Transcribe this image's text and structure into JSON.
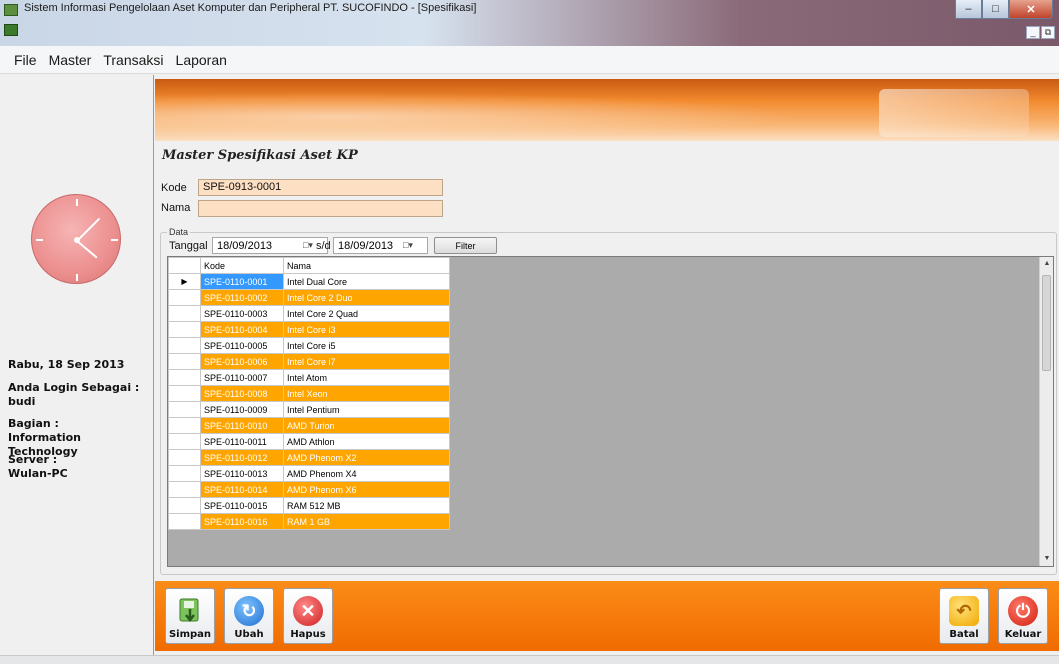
{
  "window": {
    "title": "Sistem Informasi Pengelolaan Aset Komputer dan Peripheral PT. SUCOFINDO - [Spesifikasi]"
  },
  "menu": {
    "items": [
      "File",
      "Master",
      "Transaksi",
      "Laporan"
    ]
  },
  "sidebar": {
    "date": "Rabu, 18 Sep 2013",
    "login_label": "Anda Login Sebagai :",
    "login_user": "budi",
    "bagian_label": "Bagian :",
    "bagian_value": "Information Technology",
    "server_label": "Server :",
    "server_value": "Wulan-PC"
  },
  "form": {
    "title": "Master Spesifikasi Aset KP",
    "kode_label": "Kode",
    "kode_value": "SPE-0913-0001",
    "nama_label": "Nama",
    "nama_value": "",
    "data_group_label": "Data",
    "tanggal_label": "Tanggal",
    "date_from": "18/09/2013",
    "sd_label": "s/d",
    "date_to": "18/09/2013",
    "filter_label": "Filter"
  },
  "grid": {
    "columns": [
      "Kode",
      "Nama"
    ],
    "rows": [
      [
        "SPE-0110-0001",
        "Intel Dual Core"
      ],
      [
        "SPE-0110-0002",
        "Intel Core 2 Duo"
      ],
      [
        "SPE-0110-0003",
        "Intel Core 2 Quad"
      ],
      [
        "SPE-0110-0004",
        "Intel Core i3"
      ],
      [
        "SPE-0110-0005",
        "Intel Core i5"
      ],
      [
        "SPE-0110-0006",
        "Intel Core i7"
      ],
      [
        "SPE-0110-0007",
        "Intel Atom"
      ],
      [
        "SPE-0110-0008",
        "Intel Xeon"
      ],
      [
        "SPE-0110-0009",
        "Intel Pentium"
      ],
      [
        "SPE-0110-0010",
        "AMD Turion"
      ],
      [
        "SPE-0110-0011",
        "AMD Athlon"
      ],
      [
        "SPE-0110-0012",
        "AMD Phenom X2"
      ],
      [
        "SPE-0110-0013",
        "AMD Phenom X4"
      ],
      [
        "SPE-0110-0014",
        "AMD Phenom X6"
      ],
      [
        "SPE-0110-0015",
        "RAM 512 MB"
      ],
      [
        "SPE-0110-0016",
        "RAM 1 GB"
      ]
    ],
    "alt_row_color": "#ffa500",
    "selected_cell_color": "#3399ff"
  },
  "toolbar": {
    "simpan": "Simpan",
    "ubah": "Ubah",
    "hapus": "Hapus",
    "batal": "Batal",
    "keluar": "Keluar"
  },
  "icons": {
    "simpan": "save-icon",
    "ubah": "refresh-icon",
    "hapus": "delete-icon",
    "batal": "undo-icon",
    "keluar": "power-icon"
  }
}
